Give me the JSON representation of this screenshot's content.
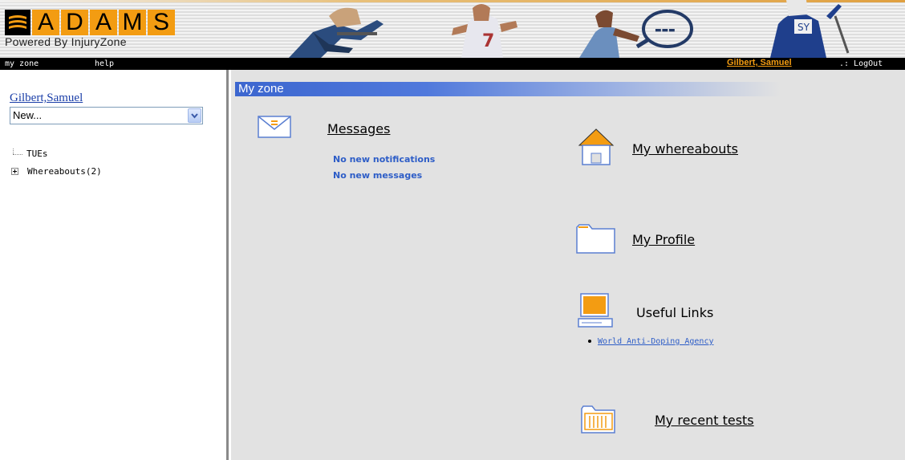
{
  "header": {
    "logo_letters": [
      "A",
      "D",
      "A",
      "M",
      "S"
    ],
    "logo_powered": "Powered By InjuryZone"
  },
  "menu": {
    "my_zone": "my zone",
    "help": "help",
    "user_link": "Gilbert, Samuel",
    "logout": ".: LogOut"
  },
  "sidebar": {
    "athlete_name": "Gilbert,Samuel",
    "select_value": "New...",
    "tree": [
      {
        "label": "TUEs"
      },
      {
        "label": "Whereabouts(2)"
      }
    ]
  },
  "main": {
    "title": "My zone",
    "messages": {
      "title": "Messages",
      "notifications": "No new notifications",
      "messages": "No new messages"
    },
    "whereabouts": {
      "title": "My whereabouts"
    },
    "profile": {
      "title": "My Profile"
    },
    "useful_links": {
      "title": "Useful Links",
      "links": [
        "World Anti-Doping Agency"
      ]
    },
    "recent_tests": {
      "title": "My recent tests"
    }
  },
  "colors": {
    "accent_orange": "#f39c12",
    "title_blue": "#3c66cf",
    "link_blue": "#2d5dc7",
    "content_bg": "#e2e2e2"
  }
}
